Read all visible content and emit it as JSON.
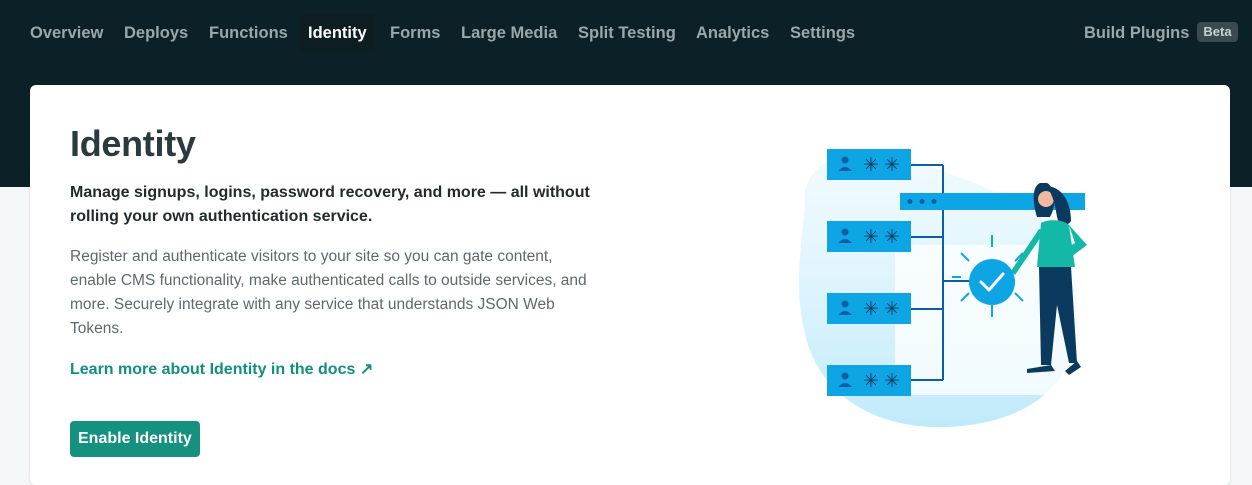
{
  "nav": {
    "tabs": [
      {
        "label": "Overview",
        "active": false
      },
      {
        "label": "Deploys",
        "active": false
      },
      {
        "label": "Functions",
        "active": false
      },
      {
        "label": "Identity",
        "active": true
      },
      {
        "label": "Forms",
        "active": false
      },
      {
        "label": "Large Media",
        "active": false
      },
      {
        "label": "Split Testing",
        "active": false
      },
      {
        "label": "Analytics",
        "active": false
      },
      {
        "label": "Settings",
        "active": false
      }
    ],
    "build_plugins": {
      "label": "Build Plugins",
      "badge": "Beta"
    }
  },
  "main": {
    "title": "Identity",
    "lead": "Manage signups, logins, password recovery, and more — all without rolling your own authentication service.",
    "description": "Register and authenticate visitors to your site so you can gate content, enable CMS functionality, make authenticated calls to outside services, and more. Securely integrate with any service that understands JSON Web Tokens.",
    "docs_link": "Learn more about Identity in the docs ↗",
    "enable_button": "Enable Identity"
  },
  "colors": {
    "header_bg": "#0b2027",
    "accent": "#15917f",
    "link": "#128f83",
    "illustration_blue": "#0ea5e4",
    "figure_teal": "#14b8a6"
  },
  "icons": [
    "user-icon",
    "asterisk-icon",
    "checkmark-icon",
    "arrow-up-right-icon"
  ]
}
